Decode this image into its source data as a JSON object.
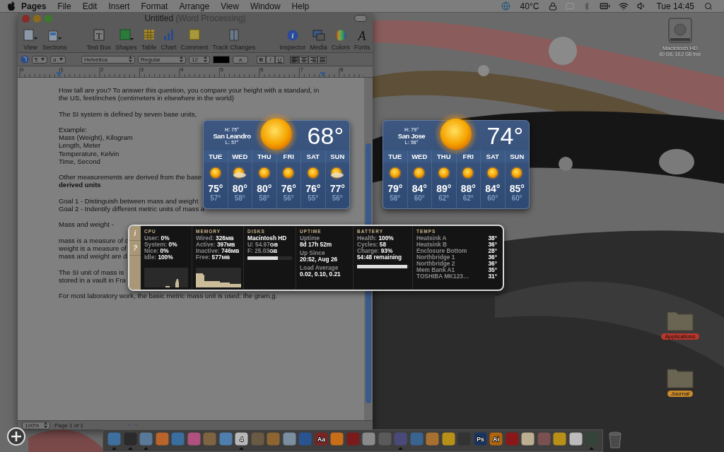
{
  "menu_bar": {
    "app_name": "Pages",
    "menus": [
      "File",
      "Edit",
      "Insert",
      "Format",
      "Arrange",
      "View",
      "Window",
      "Help"
    ],
    "temperature": "40°C",
    "clock": "Tue 14:45"
  },
  "window": {
    "title": "Untitled",
    "subtitle": "(Word Processing)",
    "toolbar": [
      {
        "kind": "view",
        "label": "View"
      },
      {
        "kind": "sections",
        "label": "Sections"
      },
      {
        "kind": "textbox",
        "label": "Text Box",
        "glyph": "T"
      },
      {
        "kind": "shapes",
        "label": "Shapes"
      },
      {
        "kind": "table",
        "label": "Table"
      },
      {
        "kind": "chart",
        "label": "Chart"
      },
      {
        "kind": "comment",
        "label": "Comment"
      },
      {
        "kind": "track",
        "label": "Track Changes"
      },
      {
        "kind": "inspector",
        "label": "Inspector",
        "glyph": "i"
      },
      {
        "kind": "media",
        "label": "Media"
      },
      {
        "kind": "colors",
        "label": "Colors"
      },
      {
        "kind": "fonts",
        "label": "Fonts",
        "glyph": "A"
      }
    ],
    "format_bar": {
      "paragraph_style": "¶",
      "character_style": "a",
      "font": "Helvetica",
      "typeface": "Regular",
      "size": "12",
      "highlight": "a",
      "styles": [
        "B",
        "I",
        "U"
      ],
      "align": [
        {
          "selected": true
        },
        {
          "selected": false
        },
        {
          "selected": false
        },
        {
          "selected": false
        }
      ]
    },
    "ruler": [
      "0",
      "1",
      "2",
      "3",
      "4",
      "5",
      "6",
      "7",
      "8"
    ],
    "paragraphs": [
      {
        "lines": [
          "How tall are you? To answer this question, you compare your height with a standard, in",
          "the US, feet/inches (centimeters in elsewhere in the world)"
        ]
      },
      {
        "lines": [
          "The SI system is defined by seven base units,"
        ]
      },
      {
        "lines": [
          "Example:",
          "Mass (Weight), Kilogram",
          "Length, Meter",
          "Temperature, Kelvin",
          "Time, Second"
        ]
      },
      {
        "lines": [
          "Other measurements are derived from the base",
          "**derived units**"
        ]
      },
      {
        "lines": [
          "Goal 1 - Distinguish between mass and weight",
          "Goal 2 - Indentify different metric units of mass a"
        ]
      },
      {
        "lines": [
          "Mass and weight -"
        ]
      },
      {
        "lines": [
          "mass is a measure of c",
          "weight is a measure of",
          "mass and weight are d"
        ]
      },
      {
        "lines": [
          "The SI unit of mass is",
          "stored in a vault in Fra"
        ]
      },
      {
        "lines": [
          "For most laboratory work, the basic metric mass unit is used: the gram,g."
        ]
      }
    ],
    "status_bar": {
      "zoom": "100%",
      "page": "Page 1 of 1"
    }
  },
  "weather": [
    {
      "high": "H: 75°",
      "city": "San Leandro",
      "low": "L: 57°",
      "temp": "68°",
      "days": [
        {
          "day": "TUE",
          "kind": "sunny",
          "high": "75°",
          "low": "57°"
        },
        {
          "day": "WED",
          "kind": "partly",
          "high": "80°",
          "low": "58°"
        },
        {
          "day": "THU",
          "kind": "sunny",
          "high": "80°",
          "low": "58°"
        },
        {
          "day": "FRI",
          "kind": "sunny",
          "high": "76°",
          "low": "56°"
        },
        {
          "day": "SAT",
          "kind": "sunny",
          "high": "76°",
          "low": "55°"
        },
        {
          "day": "SUN",
          "kind": "partly",
          "high": "77°",
          "low": "56°"
        }
      ]
    },
    {
      "high": "H: 79°",
      "city": "San Jose",
      "low": "L: 58°",
      "temp": "74°",
      "days": [
        {
          "day": "TUE",
          "kind": "sunny",
          "high": "79°",
          "low": "58°"
        },
        {
          "day": "WED",
          "kind": "sunny",
          "high": "84°",
          "low": "60°"
        },
        {
          "day": "THU",
          "kind": "sunny",
          "high": "89°",
          "low": "62°"
        },
        {
          "day": "FRI",
          "kind": "sunny",
          "high": "88°",
          "low": "62°"
        },
        {
          "day": "SAT",
          "kind": "sunny",
          "high": "84°",
          "low": "60°"
        },
        {
          "day": "SUN",
          "kind": "sunny",
          "high": "85°",
          "low": "60°"
        }
      ]
    }
  ],
  "system_stats": {
    "buttons": [
      "i",
      "?"
    ],
    "cpu": {
      "title": "CPU",
      "rows": [
        {
          "label": "User:",
          "value": "0%"
        },
        {
          "label": "System:",
          "value": "0%"
        },
        {
          "label": "Nice:",
          "value": "0%"
        },
        {
          "label": "Idle:",
          "value": "100%"
        }
      ]
    },
    "memory": {
      "title": "MEMORY",
      "rows": [
        {
          "label": "Wired:",
          "value": "326",
          "unit": "MB"
        },
        {
          "label": "Active:",
          "value": "397",
          "unit": "MB"
        },
        {
          "label": "Inactive:",
          "value": "746",
          "unit": "MB"
        },
        {
          "label": "Free:",
          "value": "577",
          "unit": "MB"
        }
      ]
    },
    "disks": {
      "title": "DISKS",
      "name": "Macintosh HD",
      "rows": [
        {
          "label": "U: 54.97",
          "unit": "GB"
        },
        {
          "label": "F: 25.03",
          "unit": "GB"
        }
      ],
      "level": 0.69
    },
    "uptime": {
      "title": "UPTIME",
      "groups": [
        {
          "label": "Uptime",
          "value": "8d 17h 52m"
        },
        {
          "label": "Up Since",
          "value": "20:52, Aug 26"
        },
        {
          "label": "Load Average",
          "value": "0.02, 0.10, 0.21"
        }
      ]
    },
    "battery": {
      "title": "BATTERY",
      "rows": [
        {
          "label": "Health:",
          "value": "100%"
        },
        {
          "label": "Cycles:",
          "value": "58"
        },
        {
          "label": "Charge:",
          "value": "93%"
        }
      ],
      "remaining": "54:48 remaining",
      "level": 0.97
    },
    "temps": {
      "title": "TEMPS",
      "rows": [
        {
          "label": "Heatsink A",
          "value": "38°"
        },
        {
          "label": "Heatsink B",
          "value": "36°"
        },
        {
          "label": "Enclosure Bottom",
          "value": "28°"
        },
        {
          "label": "Northbridge 1",
          "value": "36°"
        },
        {
          "label": "Northbridge 2",
          "value": "36°"
        },
        {
          "label": "Mem Bank A1",
          "value": "35°"
        },
        {
          "label": "TOSHIBA MK123…",
          "value": "31°"
        }
      ]
    }
  },
  "desktop_icons": [
    {
      "kind": "disk",
      "name": "Macintosh HD",
      "info": "80 GB, 15.2 GB free"
    },
    {
      "kind": "folder",
      "name": "Applications",
      "color": "#b8362c"
    },
    {
      "kind": "folder",
      "name": "Journal",
      "color": "#c98a2a"
    }
  ],
  "dock": [
    {
      "color": "#3f6f9e",
      "running": true
    },
    {
      "color": "#2a2a2a",
      "running": true
    },
    {
      "color": "#5a7898",
      "running": true
    },
    {
      "color": "#b8642a",
      "running": false
    },
    {
      "color": "#3a6e9e",
      "running": false
    },
    {
      "color": "#b0507e",
      "running": false
    },
    {
      "color": "#7e6440",
      "running": false
    },
    {
      "color": "#4f7eae",
      "running": false
    },
    {
      "color": "#b8b8b8",
      "running": true,
      "label": "4"
    },
    {
      "color": "#6a5a44",
      "running": false
    },
    {
      "color": "#8e6430",
      "running": false
    },
    {
      "color": "#7a8ea0",
      "running": false
    },
    {
      "color": "#2a5490",
      "running": false
    },
    {
      "color": "#7a2424",
      "running": false,
      "label": "Aa"
    },
    {
      "color": "#c86e18",
      "running": false
    },
    {
      "color": "#7a1a1a",
      "running": false
    },
    {
      "color": "#8a8a8a",
      "running": false
    },
    {
      "color": "#5a5a5a",
      "running": false
    },
    {
      "color": "#4a4a7a",
      "running": true
    },
    {
      "color": "#3a6490",
      "running": false
    },
    {
      "color": "#a87030",
      "running": false
    },
    {
      "color": "#b89018",
      "running": false
    },
    {
      "color": "#333333",
      "running": false
    },
    {
      "color": "#1a3460",
      "running": false,
      "label": "Ps"
    },
    {
      "color": "#b0640e",
      "running": false,
      "label": "Ai"
    },
    {
      "color": "#8a1818",
      "running": false
    },
    {
      "color": "#bcae90",
      "running": false
    },
    {
      "color": "#7a5050",
      "running": false
    },
    {
      "color": "#b89018",
      "running": false
    },
    {
      "color": "#bcbcbc",
      "running": false
    },
    {
      "color": "#34443a",
      "running": true
    }
  ]
}
